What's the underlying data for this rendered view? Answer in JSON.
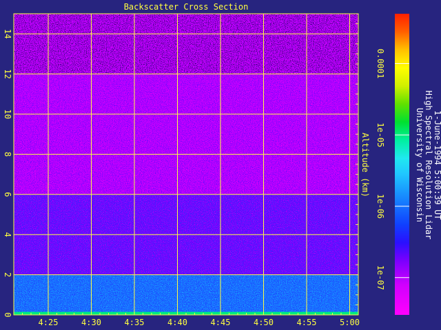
{
  "chart_data": {
    "type": "heatmap",
    "title": "Backscatter Cross Section",
    "xlabel": "",
    "ylabel": "Altitude (km)",
    "x_ticks": [
      "4:25",
      "4:30",
      "4:35",
      "4:40",
      "4:45",
      "4:50",
      "4:55",
      "5:00"
    ],
    "x_range": [
      "4:21",
      "5:01"
    ],
    "y_ticks": [
      0,
      2,
      4,
      6,
      8,
      10,
      12,
      14
    ],
    "ylim": [
      0,
      15
    ],
    "grid": true,
    "colorbar": {
      "scale": "log",
      "range": [
        3e-08,
        0.0005
      ],
      "tick_labels": [
        "1e-07",
        "1e-06",
        "1e-05",
        "0.0001"
      ],
      "tick_values": [
        1e-07,
        1e-06,
        1e-05,
        0.0001
      ]
    },
    "layers": [
      {
        "altitude_range": [
          0,
          2
        ],
        "level": "1e-06"
      },
      {
        "altitude_range": [
          2,
          6
        ],
        "level": "2e-07"
      },
      {
        "altitude_range": [
          6,
          15
        ],
        "level": "1e-07"
      }
    ],
    "annotation": [
      "University of Wisconsin",
      "High Spectral Resolution Lidar",
      "1-June-1994  5:00:39 UT"
    ],
    "colors": {
      "axes": "#ffff40",
      "background": "#27247f",
      "text": "#ffffff"
    }
  }
}
